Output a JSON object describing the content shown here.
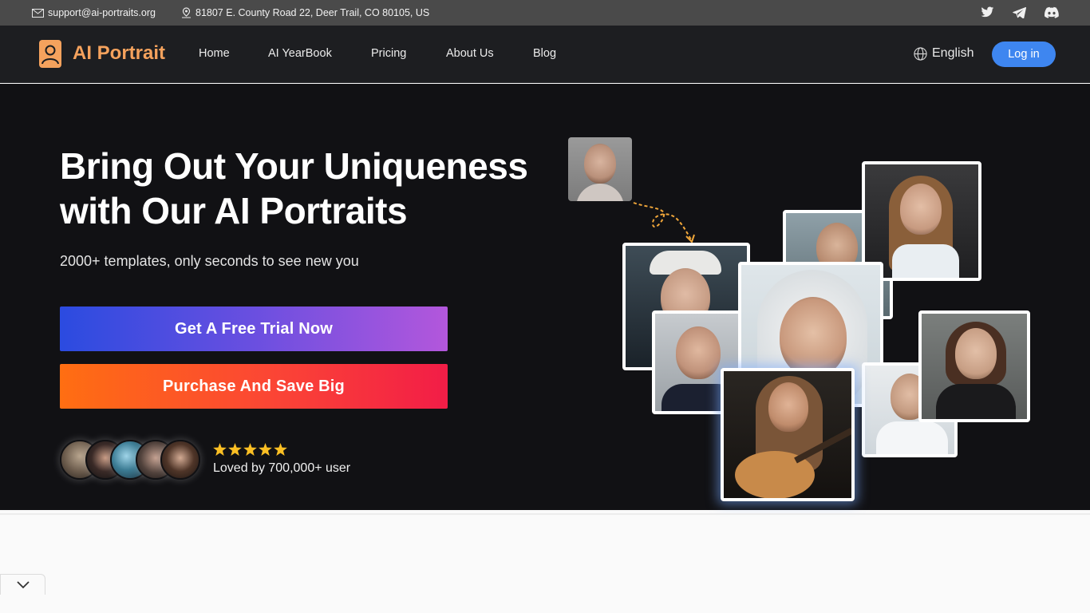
{
  "topbar": {
    "email": "support@ai-portraits.org",
    "address": "81807 E. County Road 22, Deer Trail, CO 80105, US",
    "social": [
      "twitter-icon",
      "telegram-icon",
      "discord-icon"
    ]
  },
  "header": {
    "logo_text": "AI Portrait",
    "nav": [
      "Home",
      "AI YearBook",
      "Pricing",
      "About Us",
      "Blog"
    ],
    "language": "English",
    "login": "Log in"
  },
  "hero": {
    "title": "Bring Out Your Uniqueness with Our AI Portraits",
    "subtitle": "2000+ templates, only seconds to see new you",
    "cta_primary": "Get A Free Trial Now",
    "cta_secondary": "Purchase And Save Big",
    "rating_stars": 5,
    "loved_text": "Loved by 700,000+ user"
  },
  "colors": {
    "accent_orange": "#f5a25d",
    "login_blue": "#3e86f0",
    "hero_bg": "#111114",
    "star_yellow": "#fbbf24"
  }
}
